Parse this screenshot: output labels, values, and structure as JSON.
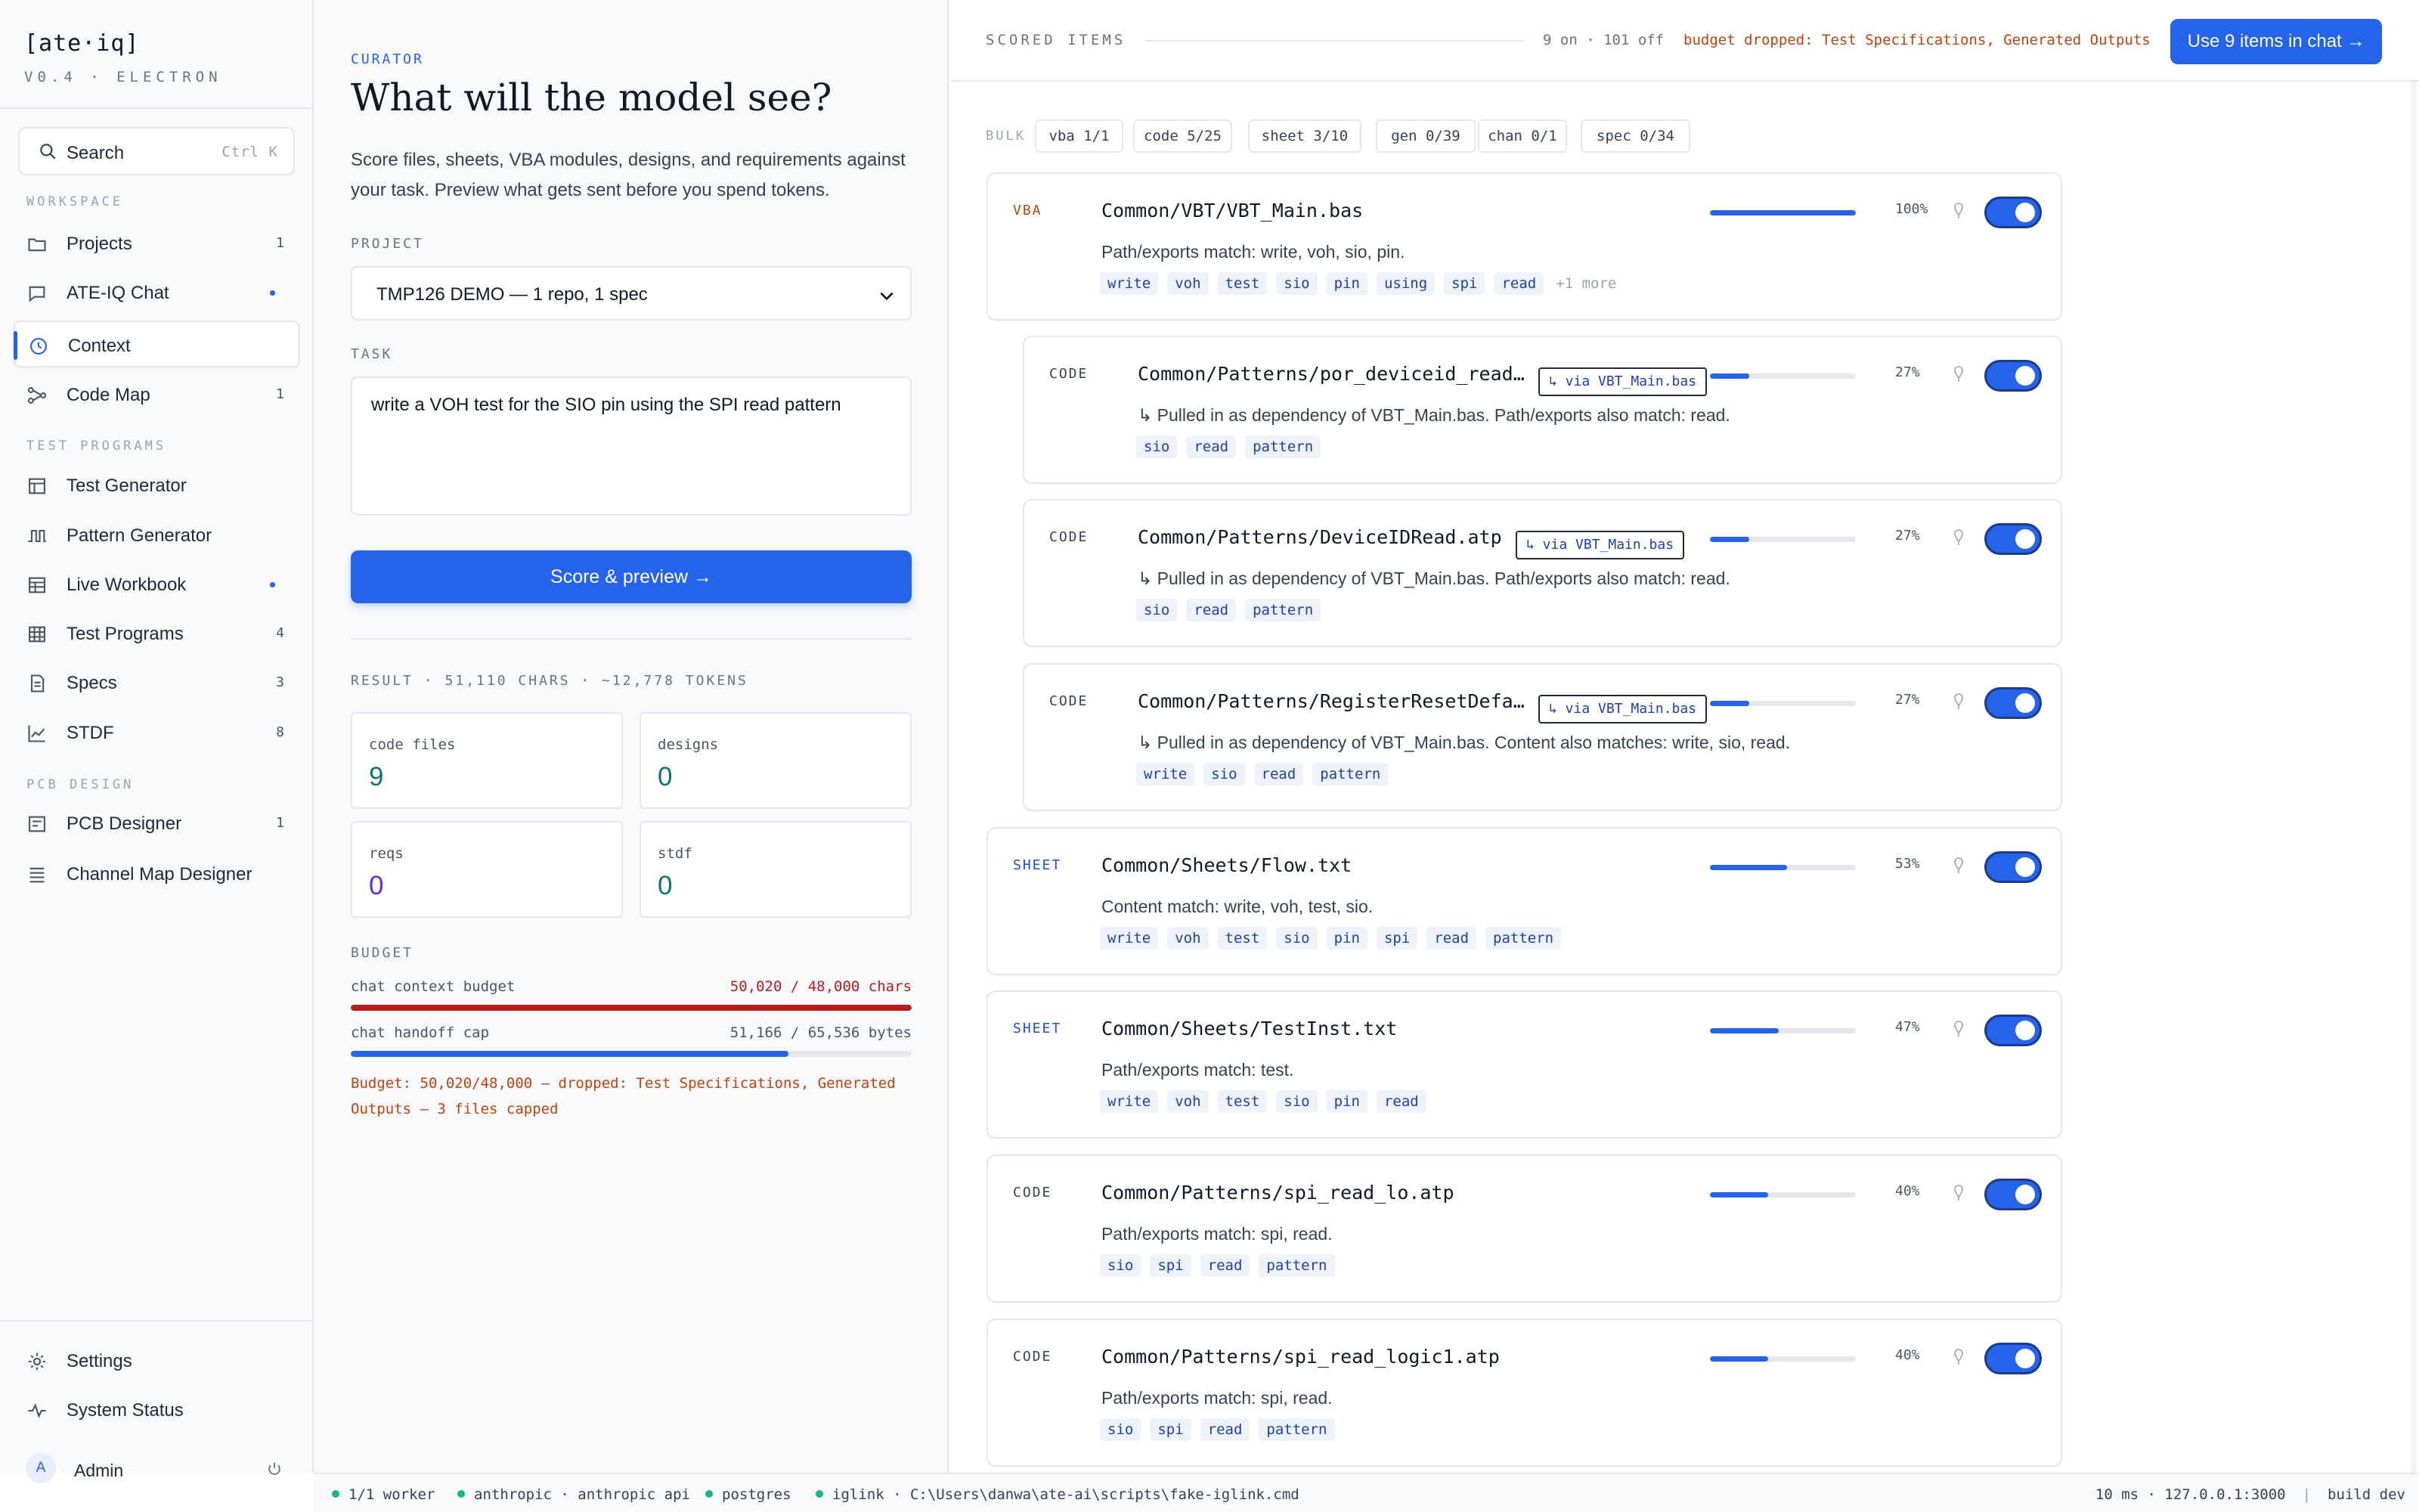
{
  "app": {
    "logo": "[ate·iq]",
    "version": "V0.4 · ELECTRON"
  },
  "search": {
    "label": "Search",
    "shortcut": "Ctrl K",
    "icon": "search-icon"
  },
  "sidebar": {
    "workspace_title": "WORKSPACE",
    "test_programs_title": "TEST PROGRAMS",
    "pcb_design_title": "PCB DESIGN",
    "items": [
      {
        "label": "Projects",
        "count": "1",
        "icon": "folder-icon"
      },
      {
        "label": "ATE-IQ Chat",
        "icon": "chat-icon"
      },
      {
        "label": "Context",
        "icon": "clock-icon"
      },
      {
        "label": "Code Map",
        "count": "1",
        "icon": "graph-icon"
      },
      {
        "label": "Test Generator",
        "icon": "table-icon"
      },
      {
        "label": "Pattern Generator",
        "icon": "waveform-icon"
      },
      {
        "label": "Live Workbook",
        "icon": "workbook-icon"
      },
      {
        "label": "Test Programs",
        "count": "4",
        "icon": "grid-icon"
      },
      {
        "label": "Specs",
        "count": "3",
        "icon": "document-icon"
      },
      {
        "label": "STDF",
        "count": "8",
        "icon": "line-chart-icon"
      },
      {
        "label": "PCB Designer",
        "count": "1",
        "icon": "board-icon"
      },
      {
        "label": "Channel Map Designer",
        "icon": "list-icon"
      }
    ],
    "settings": "Settings",
    "system_status": "System Status",
    "admin_initial": "A",
    "admin": "Admin"
  },
  "curator": {
    "kicker": "CURATOR",
    "title": "What will the model see?",
    "description": "Score files, sheets, VBA modules, designs, and requirements against your task. Preview what gets sent before you spend tokens.",
    "project_label": "PROJECT",
    "project_value": "TMP126 DEMO — 1 repo, 1 spec",
    "task_label": "TASK",
    "task_value": "write a VOH test for the SIO pin using the SPI read pattern",
    "score_button": "Score & preview →",
    "result_line": "RESULT · 51,110 CHARS · ~12,778 TOKENS",
    "stats": [
      {
        "label": "code files",
        "value": "9",
        "color": "#0f766e"
      },
      {
        "label": "designs",
        "value": "0",
        "color": "#0f766e"
      },
      {
        "label": "reqs",
        "value": "0",
        "color": "#6d28d9"
      },
      {
        "label": "stdf",
        "value": "0",
        "color": "#0f766e"
      }
    ],
    "budget_title": "BUDGET",
    "budget_rows": [
      {
        "label": "chat context budget",
        "value": "50,020 / 48,000 chars",
        "fill": 1.0,
        "color": "#b91c1c"
      },
      {
        "label": "chat handoff cap",
        "value": "51,166 / 65,536 bytes",
        "fill": 0.78,
        "color": "#2563eb"
      }
    ],
    "budget_note": "Budget: 50,020/48,000 — dropped: Test Specifications, Generated Outputs — 3 files capped"
  },
  "scored": {
    "title": "SCORED ITEMS",
    "count": "9 on · 101 off",
    "dropped": "budget dropped: Test Specifications, Generated Outputs",
    "use_button": "Use 9 items in chat →",
    "bulk_label": "BULK",
    "bulk": [
      "vba 1/1",
      "code 5/25",
      "sheet 3/10",
      "gen 0/39",
      "chan 0/1",
      "spec 0/34"
    ],
    "items": [
      {
        "type": "VBA",
        "type_color": "#c2410c",
        "path": "Common/VBT/VBT_Main.bas",
        "score": 1.0,
        "pct": "100%",
        "message": "Path/exports match: write, voh, sio, pin.",
        "chips": [
          "write",
          "voh",
          "test",
          "sio",
          "pin",
          "using",
          "spi",
          "read"
        ],
        "more": "+1 more",
        "enabled": true
      },
      {
        "type": "CODE",
        "type_color": "#374151",
        "path": "Common/Patterns/por_deviceid_read…",
        "via": "↳ via VBT_Main.bas",
        "score": 0.27,
        "pct": "27%",
        "message": "↳ Pulled in as dependency of VBT_Main.bas. Path/exports also match: read.",
        "chips": [
          "sio",
          "read",
          "pattern"
        ],
        "enabled": true
      },
      {
        "type": "CODE",
        "type_color": "#374151",
        "path": "Common/Patterns/DeviceIDRead.atp",
        "via": "↳ via VBT_Main.bas",
        "score": 0.27,
        "pct": "27%",
        "message": "↳ Pulled in as dependency of VBT_Main.bas. Path/exports also match: read.",
        "chips": [
          "sio",
          "read",
          "pattern"
        ],
        "enabled": true
      },
      {
        "type": "CODE",
        "type_color": "#374151",
        "path": "Common/Patterns/RegisterResetDefa…",
        "via": "↳ via VBT_Main.bas",
        "score": 0.27,
        "pct": "27%",
        "message": "↳ Pulled in as dependency of VBT_Main.bas. Content also matches: write, sio, read.",
        "chips": [
          "write",
          "sio",
          "read",
          "pattern"
        ],
        "enabled": true
      },
      {
        "type": "SHEET",
        "type_color": "#1d4ed8",
        "path": "Common/Sheets/Flow.txt",
        "score": 0.53,
        "pct": "53%",
        "message": "Content match: write, voh, test, sio.",
        "chips": [
          "write",
          "voh",
          "test",
          "sio",
          "pin",
          "spi",
          "read",
          "pattern"
        ],
        "enabled": true
      },
      {
        "type": "SHEET",
        "type_color": "#1d4ed8",
        "path": "Common/Sheets/TestInst.txt",
        "score": 0.47,
        "pct": "47%",
        "message": "Path/exports match: test.",
        "chips": [
          "write",
          "voh",
          "test",
          "sio",
          "pin",
          "read"
        ],
        "enabled": true
      },
      {
        "type": "CODE",
        "type_color": "#374151",
        "path": "Common/Patterns/spi_read_lo.atp",
        "score": 0.4,
        "pct": "40%",
        "message": "Path/exports match: spi, read.",
        "chips": [
          "sio",
          "spi",
          "read",
          "pattern"
        ],
        "enabled": true
      },
      {
        "type": "CODE",
        "type_color": "#374151",
        "path": "Common/Patterns/spi_read_logic1.atp",
        "score": 0.4,
        "pct": "40%",
        "message": "Path/exports match: spi, read.",
        "chips": [
          "sio",
          "spi",
          "read",
          "pattern"
        ],
        "enabled": true
      }
    ]
  },
  "status": {
    "items": [
      "1/1 worker",
      "anthropic · anthropic api",
      "postgres",
      "iglink · C:\\Users\\danwa\\ate-ai\\scripts\\fake-iglink.cmd"
    ],
    "latency": "10 ms · 127.0.0.1:3000",
    "build": "build dev"
  }
}
